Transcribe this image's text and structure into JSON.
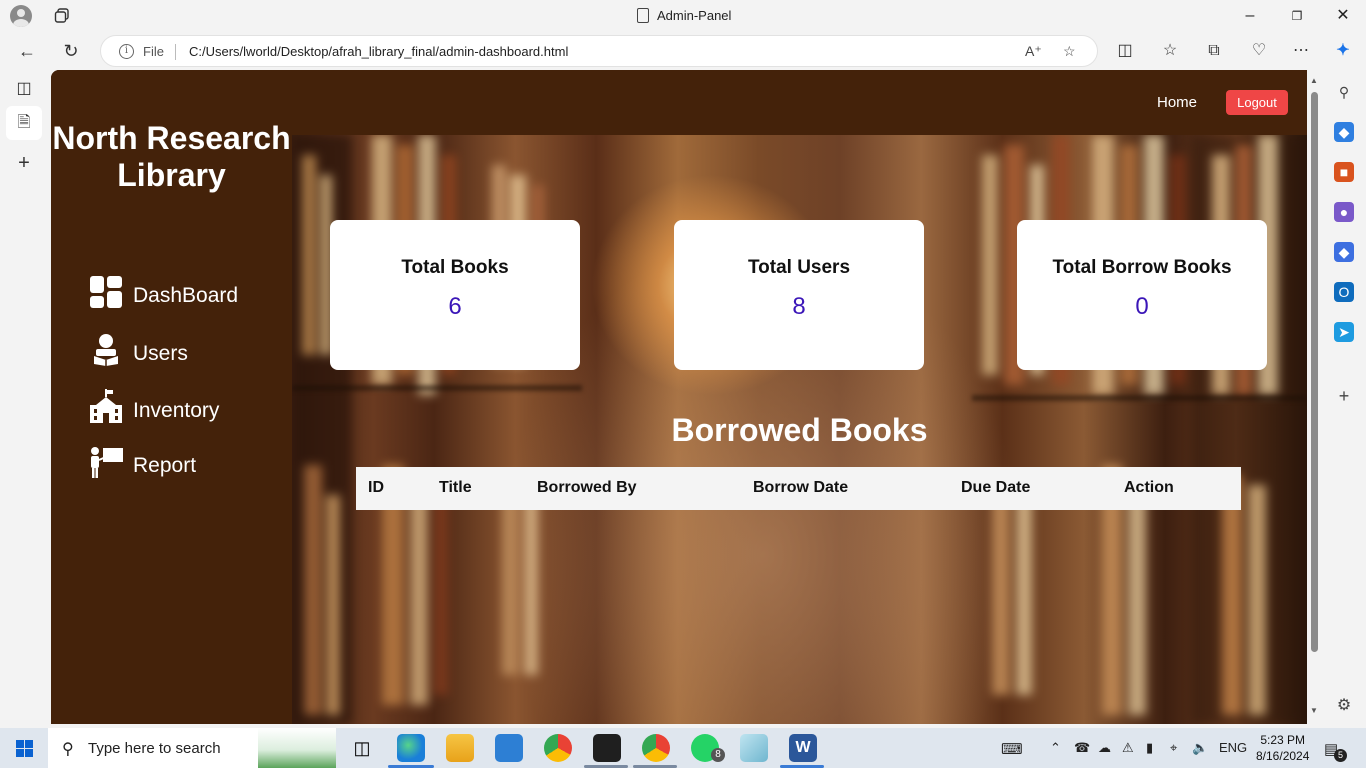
{
  "browser": {
    "window_title": "Admin-Panel",
    "url_scheme_label": "File",
    "url": "C:/Users/lworld/Desktop/afrah_library_final/admin-dashboard.html"
  },
  "page": {
    "header": {
      "home_label": "Home",
      "logout_label": "Logout"
    },
    "sidebar": {
      "brand": "North Research Library",
      "items": [
        {
          "label": "DashBoard",
          "icon": "dashboard-icon"
        },
        {
          "label": "Users",
          "icon": "reader-icon"
        },
        {
          "label": "Inventory",
          "icon": "school-icon"
        },
        {
          "label": "Report",
          "icon": "teacher-icon"
        }
      ]
    },
    "stats": [
      {
        "title": "Total Books",
        "value": "6"
      },
      {
        "title": "Total Users",
        "value": "8"
      },
      {
        "title": "Total Borrow Books",
        "value": "0"
      }
    ],
    "borrowed": {
      "title": "Borrowed Books",
      "columns": [
        "ID",
        "Title",
        "Borrowed By",
        "Borrow Date",
        "Due Date",
        "Action"
      ]
    }
  },
  "taskbar": {
    "search_placeholder": "Type here to search",
    "language": "ENG",
    "time": "5:23 PM",
    "date": "8/16/2024",
    "whatsapp_badge": "8",
    "notification_badge": "5"
  },
  "colors": {
    "brown": "#44220a",
    "logout": "#ef4646",
    "stat_value": "#3b16b8"
  }
}
